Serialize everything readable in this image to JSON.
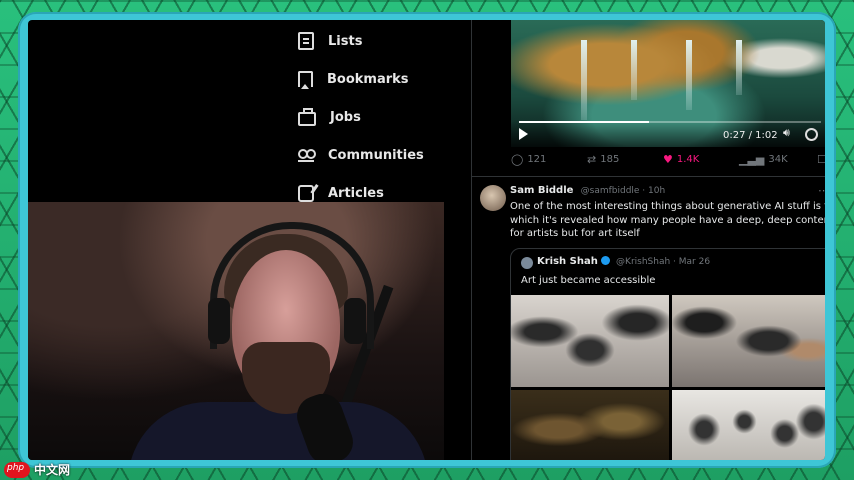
{
  "nav": {
    "items": [
      {
        "label": "Lists",
        "icon": "list-icon"
      },
      {
        "label": "Bookmarks",
        "icon": "bookmark-icon"
      },
      {
        "label": "Jobs",
        "icon": "jobs-icon"
      },
      {
        "label": "Communities",
        "icon": "communities-icon"
      },
      {
        "label": "Articles",
        "icon": "articles-icon"
      }
    ]
  },
  "video": {
    "time": "0:27 / 1:02",
    "progress": 0.43
  },
  "actions": {
    "reply": "121",
    "retweet": "185",
    "like": "1.4K",
    "views": "34K"
  },
  "tweet": {
    "name": "Sam Biddle",
    "handle": "@samfbiddle · 10h",
    "lines": [
      "One of the most interesting things about generative AI stuff is the exte",
      "which it's revealed how many people have a deep, deep contempt not j",
      "for artists but for art itself"
    ],
    "quote": {
      "name": "Krish Shah",
      "handle": "@KrishShah · Mar 26",
      "text": "Art just became accessible"
    }
  },
  "watermark": {
    "text": "中文网"
  },
  "colors": {
    "frame": "#3ec6d6",
    "background": "#1fa86a",
    "like": "#f91880"
  }
}
